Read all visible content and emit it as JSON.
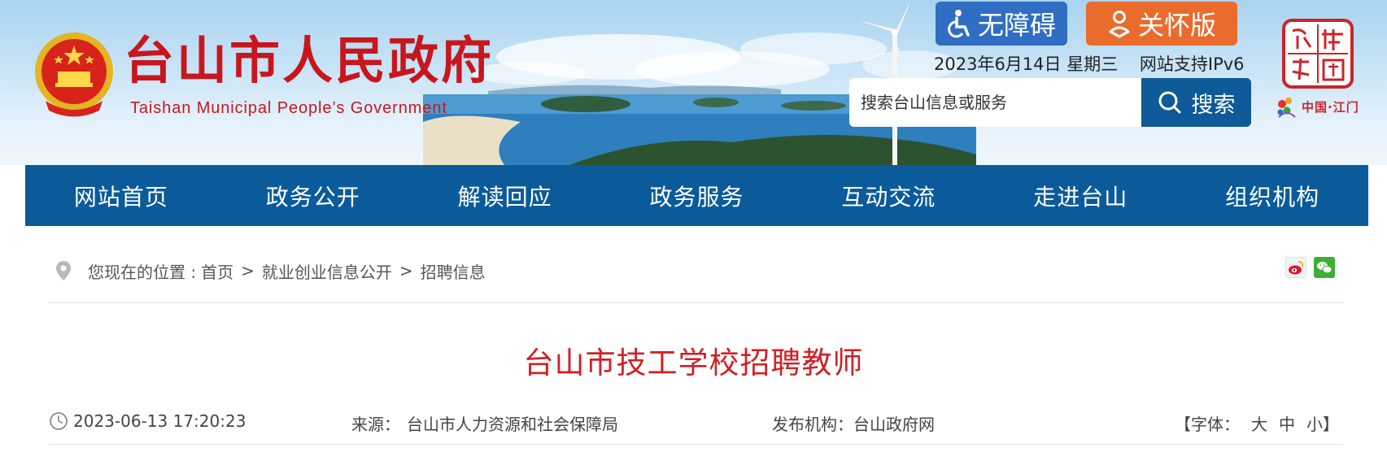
{
  "header": {
    "title": "台山市人民政府",
    "subtitle": "Taishan Municipal People’s Government",
    "accessibility_label": "无障碍",
    "care_mode_label": "关怀版",
    "date": "2023年6月14日 星期三",
    "ipv6_note": "网站支持IPv6",
    "search": {
      "placeholder": "搜索台山信息或服务",
      "button_label": "搜索"
    },
    "emblem_icon": "national-emblem-icon",
    "seal_text": "侨都中国",
    "jiangmen_label": "中国·江门",
    "colors": {
      "title_red": "#c8161d",
      "nav_blue": "#0b5b9b",
      "care_orange": "#ea6c2c",
      "access_blue": "#2f6ec2"
    }
  },
  "nav": {
    "items": [
      {
        "label": "网站首页"
      },
      {
        "label": "政务公开"
      },
      {
        "label": "解读回应"
      },
      {
        "label": "政务服务"
      },
      {
        "label": "互动交流"
      },
      {
        "label": "走进台山"
      },
      {
        "label": "组织机构"
      }
    ]
  },
  "breadcrumb": {
    "prefix": "您现在的位置 :",
    "items": [
      {
        "label": "首页"
      },
      {
        "label": "就业创业信息公开"
      },
      {
        "label": "招聘信息"
      }
    ],
    "separator": ">"
  },
  "share": {
    "weibo_icon": "weibo-icon",
    "wechat_icon": "wechat-icon"
  },
  "article": {
    "title": "台山市技工学校招聘教师",
    "time": "2023-06-13 17:20:23",
    "source_label": "来源：",
    "source": "台山市人力资源和社会保障局",
    "publisher_label": "发布机构：",
    "publisher": "台山政府网",
    "font_label_open": "【字体：",
    "font_large": "大",
    "font_medium": "中",
    "font_small": "小",
    "font_label_close": "】"
  }
}
